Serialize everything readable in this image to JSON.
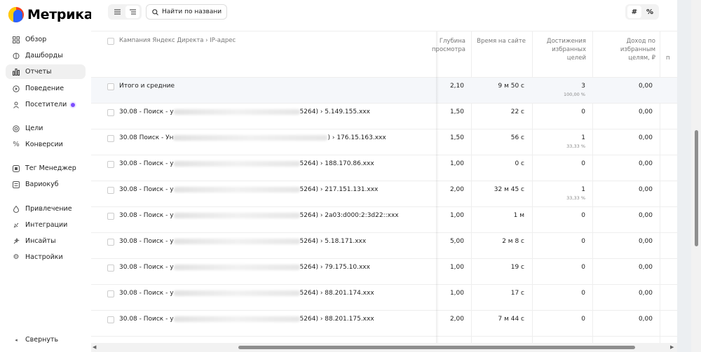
{
  "app": {
    "name": "Метрика"
  },
  "sidebar": {
    "items": [
      {
        "label": "Обзор",
        "icon": "grid-icon",
        "active": false
      },
      {
        "label": "Дашборды",
        "icon": "dashboard-icon",
        "active": false
      },
      {
        "label": "Отчеты",
        "icon": "bar-chart-icon",
        "active": true
      },
      {
        "label": "Поведение",
        "icon": "play-icon",
        "active": false
      },
      {
        "label": "Посетители",
        "icon": "person-icon",
        "active": false,
        "badge": true
      },
      {
        "label": "Цели",
        "icon": "target-icon",
        "active": false
      },
      {
        "label": "Конверсии",
        "icon": "percent-icon",
        "active": false
      },
      {
        "label": "Тег Менеджер",
        "icon": "tag-icon",
        "active": false
      },
      {
        "label": "Вариокуб",
        "icon": "cube-icon",
        "active": false
      },
      {
        "label": "Привлечение",
        "icon": "flame-icon",
        "active": false
      },
      {
        "label": "Интеграции",
        "icon": "plug-icon",
        "active": false
      },
      {
        "label": "Инсайты",
        "icon": "sparkle-icon",
        "active": false
      },
      {
        "label": "Настройки",
        "icon": "gear-icon",
        "active": false
      }
    ],
    "collapse_label": "Свернуть"
  },
  "toolbar": {
    "search_placeholder": "Найти по названию",
    "fmt_number": "#",
    "fmt_percent": "%"
  },
  "table": {
    "dimension_header": "Кампания Яндекс Директа › IP-адрес",
    "columns": [
      "Глубина просмотра",
      "Время на сайте",
      "Достижения избранных целей",
      "Доход по избранным целям, ₽",
      "п"
    ],
    "totals": {
      "label": "Итого и средние",
      "depth": "2,10",
      "time": "9 м 50 с",
      "goals": "3",
      "goals_pct": "100,00 %",
      "income": "0,00"
    },
    "rows": [
      {
        "prefix": "30.08 - Поиск - у",
        "suffix": "5264) › 5.149.155.xxx",
        "depth": "1,50",
        "time": "22 с",
        "goals": "0",
        "goals_pct": "",
        "income": "0,00"
      },
      {
        "prefix": "30.08 Поиск - Ун",
        "suffix": ") › 176.15.163.xxx",
        "depth": "1,50",
        "time": "56 с",
        "goals": "1",
        "goals_pct": "33,33 %",
        "income": "0,00"
      },
      {
        "prefix": "30.08 - Поиск - у",
        "suffix": "5264) › 188.170.86.xxx",
        "depth": "1,00",
        "time": "0 с",
        "goals": "0",
        "goals_pct": "",
        "income": "0,00"
      },
      {
        "prefix": "30.08 - Поиск - у",
        "suffix": "5264) › 217.151.131.xxx",
        "depth": "2,00",
        "time": "32 м 45 с",
        "goals": "1",
        "goals_pct": "33,33 %",
        "income": "0,00"
      },
      {
        "prefix": "30.08 - Поиск - у",
        "suffix": "5264) › 2a03:d000:2:3d22::xxx",
        "depth": "1,00",
        "time": "1 м",
        "goals": "0",
        "goals_pct": "",
        "income": "0,00"
      },
      {
        "prefix": "30.08 - Поиск - у",
        "suffix": "5264) › 5.18.171.xxx",
        "depth": "5,00",
        "time": "2 м 8 с",
        "goals": "0",
        "goals_pct": "",
        "income": "0,00"
      },
      {
        "prefix": "30.08 - Поиск - у",
        "suffix": "5264) › 79.175.10.xxx",
        "depth": "1,00",
        "time": "19 с",
        "goals": "0",
        "goals_pct": "",
        "income": "0,00"
      },
      {
        "prefix": "30.08 - Поиск - у",
        "suffix": "5264) › 88.201.174.xxx",
        "depth": "1,00",
        "time": "17 с",
        "goals": "0",
        "goals_pct": "",
        "income": "0,00"
      },
      {
        "prefix": "30.08 - Поиск - у",
        "suffix": "5264) › 88.201.175.xxx",
        "depth": "2,00",
        "time": "7 м 44 с",
        "goals": "0",
        "goals_pct": "",
        "income": "0,00"
      }
    ]
  }
}
